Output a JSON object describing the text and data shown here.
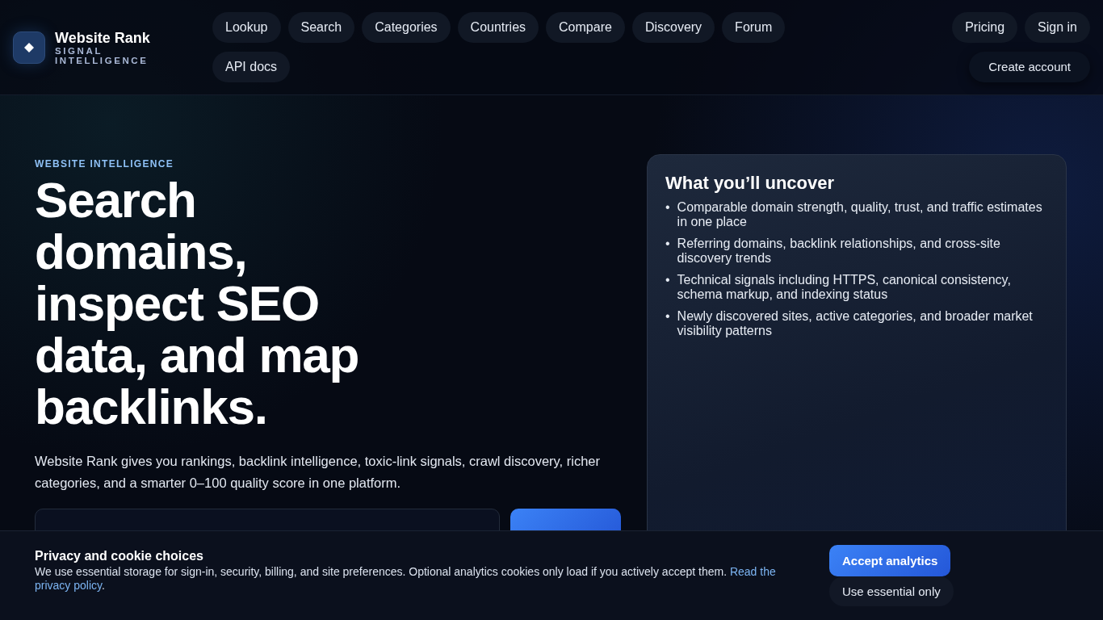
{
  "brand": {
    "name": "Website Rank",
    "tagline": "SIGNAL INTELLIGENCE"
  },
  "nav": [
    {
      "label": "Lookup"
    },
    {
      "label": "Search"
    },
    {
      "label": "Categories"
    },
    {
      "label": "Countries"
    },
    {
      "label": "Compare"
    },
    {
      "label": "Discovery"
    },
    {
      "label": "Forum"
    },
    {
      "label": "API docs"
    }
  ],
  "account_nav": [
    {
      "label": "Pricing",
      "kind": "pill"
    },
    {
      "label": "Sign in",
      "kind": "pill"
    },
    {
      "label": "Create account",
      "kind": "cta"
    }
  ],
  "hero": {
    "eyebrow": "WEBSITE INTELLIGENCE",
    "headline": "Search domains, inspect SEO data, and map backlinks.",
    "lead": "Website Rank gives you rankings, backlink intelligence, toxic-link signals, crawl discovery, richer categories, and a smarter 0–100 quality score in one platform."
  },
  "uncover": {
    "title": "What you’ll uncover",
    "bullet": "•",
    "items": [
      "Comparable domain strength, quality, trust, and traffic estimates in one place",
      "Referring domains, backlink relationships, and cross-site discovery trends",
      "Technical signals including HTTPS, canonical consistency, schema markup, and indexing status",
      "Newly discovered sites, active categories, and broader market visibility patterns"
    ]
  },
  "cookie_banner": {
    "title": "Privacy and cookie choices",
    "text": "We use essential storage for sign-in, security, billing, and site preferences. Optional analytics cookies only load if you actively accept them.",
    "link": "Read the privacy policy",
    "after_link": ".",
    "buttons": [
      {
        "label": "Accept analytics",
        "kind": "primary"
      },
      {
        "label": "Use essential only",
        "kind": "secondary"
      }
    ]
  }
}
